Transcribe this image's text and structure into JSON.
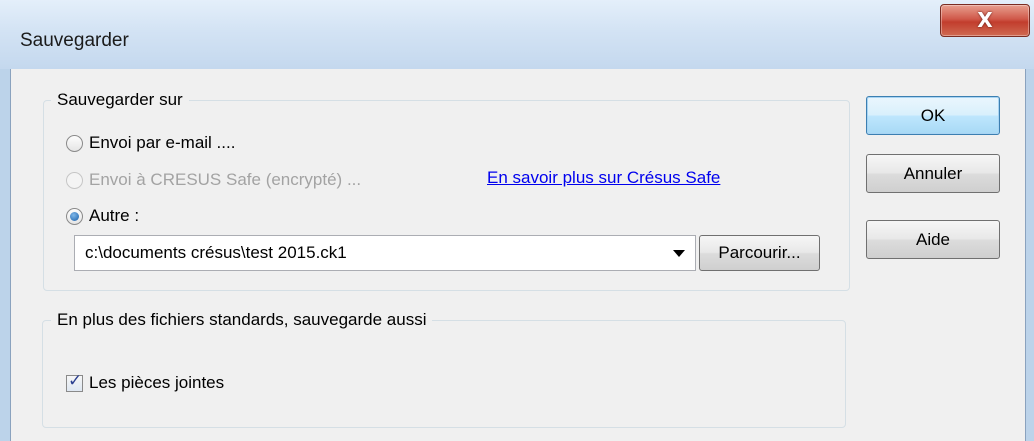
{
  "window": {
    "title": "Sauvegarder",
    "close_glyph": "X"
  },
  "group_destination": {
    "legend": "Sauvegarder sur",
    "options": [
      {
        "label": "Envoi par e-mail ....",
        "checked": false,
        "enabled": true
      },
      {
        "label": "Envoi à CRESUS Safe (encrypté) ...",
        "checked": false,
        "enabled": false
      },
      {
        "label": "Autre :",
        "checked": true,
        "enabled": true
      }
    ],
    "link": "En savoir plus sur Crésus Safe",
    "path_value": "c:\\documents crésus\\test 2015.ck1",
    "browse_label": "Parcourir..."
  },
  "group_extra": {
    "legend": "En plus des fichiers standards, sauvegarde aussi",
    "checkbox_label": "Les pièces jointes",
    "checked": true
  },
  "buttons": {
    "ok": "OK",
    "cancel": "Annuler",
    "help": "Aide"
  }
}
